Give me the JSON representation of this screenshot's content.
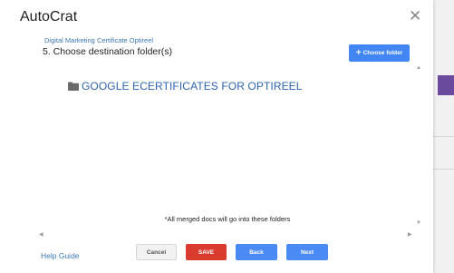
{
  "dialog": {
    "title": "AutoCrat",
    "close_icon": "close-icon"
  },
  "header": {
    "sheet_name": "Digital Marketing Certificate Optireel",
    "step_label": "5. Choose destination folder(s)",
    "choose_button": {
      "plus": "+",
      "label": "Choose folder"
    }
  },
  "folders": [
    {
      "icon": "folder-icon",
      "name": "GOOGLE ECERTIFICATES FOR OPTIREEL"
    }
  ],
  "note": "*All merged docs will go into these folders",
  "footer": {
    "help_label": "Help Guide",
    "buttons": {
      "cancel": "Cancel",
      "save": "SAVE",
      "back": "Back",
      "next": "Next"
    }
  },
  "colors": {
    "primary": "#4285f4",
    "save": "#d93b2f",
    "link": "#3c78b4",
    "folder_text": "#2e64b0"
  }
}
